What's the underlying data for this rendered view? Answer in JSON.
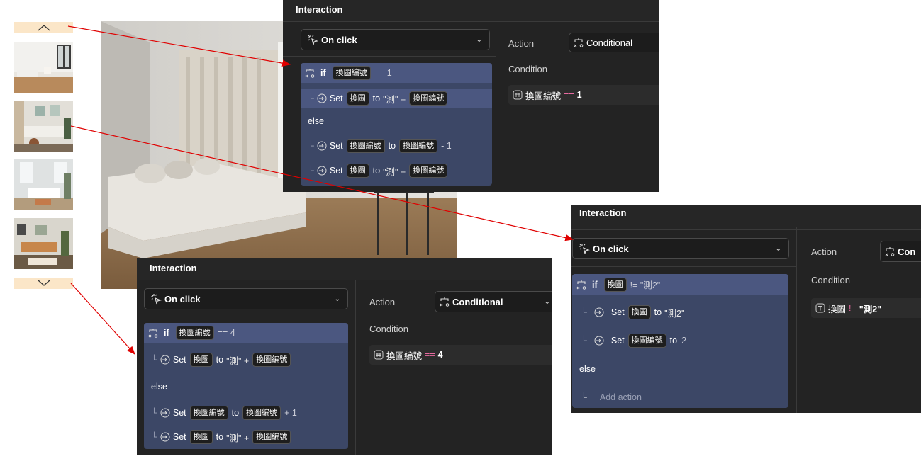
{
  "gallery": {
    "up_icon": "chevron-up-icon",
    "down_icon": "chevron-down-icon",
    "thumbnails": [
      "living-room-photo-1",
      "living-room-photo-2",
      "living-room-photo-3",
      "living-room-photo-4"
    ]
  },
  "panels": [
    {
      "title": "Interaction",
      "trigger": "On click",
      "if_keyword": "if",
      "if_var": "換圖編號",
      "if_op": "== 1",
      "set_keyword": "Set",
      "to_keyword": "to",
      "then_var": "換圖",
      "then_value": "\"測\" +",
      "then_value_var": "換圖編號",
      "else_label": "else",
      "else1_var": "換圖編號",
      "else1_value_var": "換圖編號",
      "else1_suffix": "- 1",
      "else2_var": "換圖",
      "else2_value": "\"測\" +",
      "else2_value_var": "換圖編號",
      "action_label": "Action",
      "action_value": "Conditional",
      "condition_label": "Condition",
      "cond_var": "換圖編號",
      "cond_op": "==",
      "cond_val": "1"
    },
    {
      "title": "Interaction",
      "trigger": "On click",
      "if_keyword": "if",
      "if_var": "換圖編號",
      "if_op": "== 4",
      "set_keyword": "Set",
      "to_keyword": "to",
      "then_var": "換圖",
      "then_value": "\"測\" +",
      "then_value_var": "換圖編號",
      "else_label": "else",
      "else1_var": "換圖編號",
      "else1_value_var": "換圖編號",
      "else1_suffix": "+ 1",
      "else2_var": "換圖",
      "else2_value": "\"測\" +",
      "else2_value_var": "換圖編號",
      "action_label": "Action",
      "action_value": "Conditional",
      "condition_label": "Condition",
      "cond_var": "換圖編號",
      "cond_op": "==",
      "cond_val": "4"
    },
    {
      "title": "Interaction",
      "trigger": "On click",
      "if_keyword": "if",
      "if_var": "換圖",
      "if_op": "!= \"測2\"",
      "set_keyword": "Set",
      "to_keyword": "to",
      "then_var": "換圖",
      "then_value": "\"測2\"",
      "then2_var": "換圖編號",
      "then2_value": "2",
      "else_label": "else",
      "add_action": "Add action",
      "action_label": "Action",
      "action_value": "Con",
      "condition_label": "Condition",
      "cond_var": "換圖",
      "cond_op": "!=",
      "cond_val": "\"測2\""
    }
  ],
  "colors": {
    "arrow": "#e00000",
    "panel_bg": "#232323",
    "rule_bg": "#3c4766",
    "rule_highlight": "#4b5780",
    "nav_bg": "#fbe6c8"
  }
}
